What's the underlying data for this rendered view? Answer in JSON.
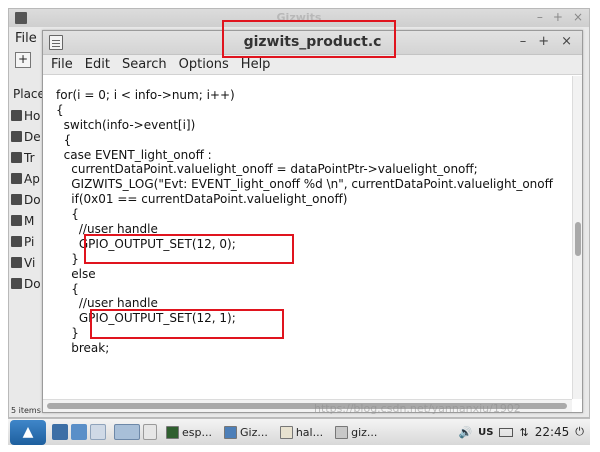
{
  "background_window": {
    "title": "Gizwits",
    "controls": [
      "–",
      "+",
      "×"
    ],
    "menu_label": "File",
    "toolbar_plus": "+",
    "sidebar_heading": "Place",
    "sidebar_items": [
      {
        "label": "Ho",
        "icon": "home-icon"
      },
      {
        "label": "De",
        "icon": "desktop-icon"
      },
      {
        "label": "Tr",
        "icon": "trash-icon"
      },
      {
        "label": "Ap",
        "icon": "applications-icon"
      },
      {
        "label": "Do",
        "icon": "documents-folder-icon"
      },
      {
        "label": "M",
        "icon": "music-folder-icon"
      },
      {
        "label": "Pi",
        "icon": "pictures-folder-icon"
      },
      {
        "label": "Vi",
        "icon": "videos-folder-icon"
      },
      {
        "label": "Do",
        "icon": "downloads-folder-icon"
      }
    ],
    "status": "5 items"
  },
  "editor": {
    "title": "gizwits_product.c",
    "controls": [
      "–",
      "+",
      "×"
    ],
    "menu": [
      "File",
      "Edit",
      "Search",
      "Options",
      "Help"
    ],
    "code_lines": [
      "for(i = 0; i < info->num; i++)",
      "{",
      "  switch(info->event[i])",
      "  {",
      "  case EVENT_light_onoff :",
      "    currentDataPoint.valuelight_onoff = dataPointPtr->valuelight_onoff;",
      "    GIZWITS_LOG(\"Evt: EVENT_light_onoff %d \\n\", currentDataPoint.valuelight_onoff",
      "    if(0x01 == currentDataPoint.valuelight_onoff)",
      "    {",
      "      //user handle",
      "      GPIO_OUTPUT_SET(12, 0);",
      "    }",
      "    else",
      "    {",
      "      //user handle",
      "      GPIO_OUTPUT_SET(12, 1);",
      "    }",
      "    break;"
    ]
  },
  "taskbar": {
    "start_icon": "start-menu-icon",
    "tasks": [
      {
        "label": "esp...",
        "icon": "terminal-icon"
      },
      {
        "label": "Giz...",
        "icon": "folder-icon"
      },
      {
        "label": "hal...",
        "icon": "text-editor-icon"
      },
      {
        "label": "giz...",
        "icon": "text-editor-icon"
      }
    ],
    "tray_keyboard": "US",
    "clock": "22:45"
  },
  "watermark": "https://blog.csdn.net/yannanxiu/1902",
  "colors": {
    "highlight": "#e0141e",
    "start_button": "#1e5f9e"
  }
}
